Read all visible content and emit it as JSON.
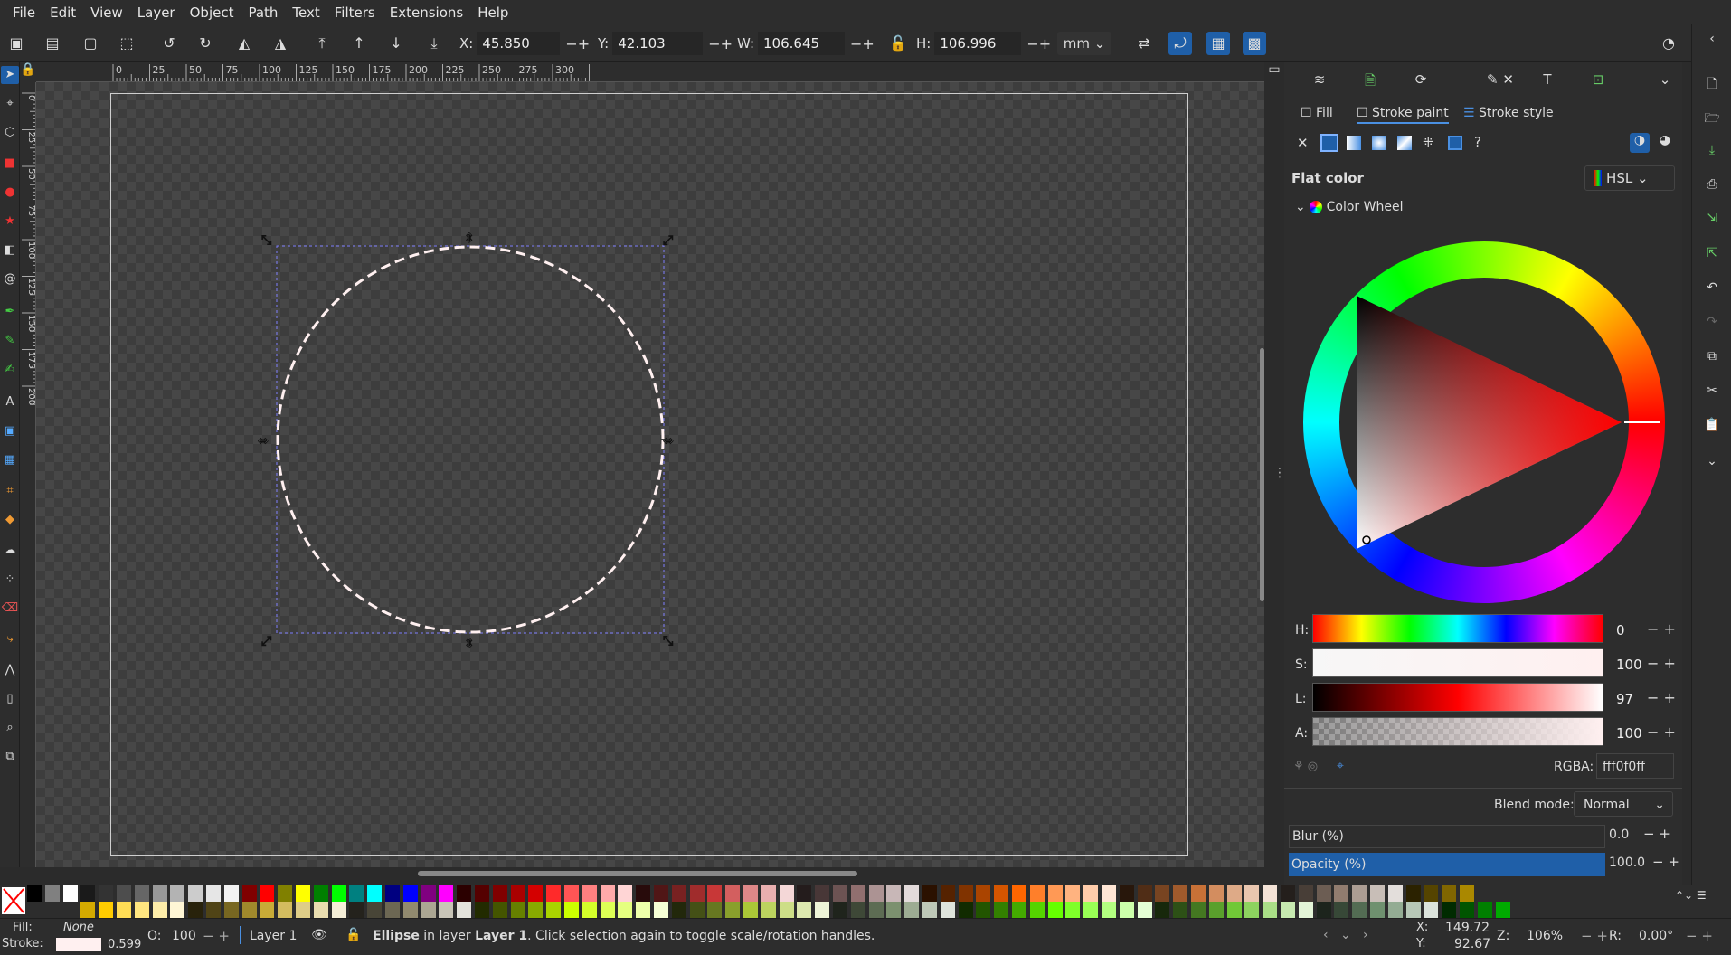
{
  "menu": [
    "File",
    "Edit",
    "View",
    "Layer",
    "Object",
    "Path",
    "Text",
    "Filters",
    "Extensions",
    "Help"
  ],
  "toolbar": {
    "x_label": "X:",
    "x_value": "45.850",
    "y_label": "Y:",
    "y_value": "42.103",
    "w_label": "W:",
    "w_value": "106.645",
    "h_label": "H:",
    "h_value": "106.996",
    "unit": "mm"
  },
  "ruler": {
    "h_ticks": [
      "0",
      "25",
      "50",
      "75",
      "100",
      "125",
      "150",
      "175",
      "200",
      "225",
      "250",
      "275",
      "300"
    ],
    "v_ticks": [
      "0",
      "25",
      "50",
      "75",
      "100",
      "125",
      "150",
      "175",
      "200"
    ]
  },
  "panel": {
    "tabs": {
      "fill": "Fill",
      "stroke_paint": "Stroke paint",
      "stroke_style": "Stroke style"
    },
    "flat_color": "Flat color",
    "color_mode": "HSL",
    "wheel_label": "Color Wheel",
    "h_label": "H:",
    "h_value": "0",
    "s_label": "S:",
    "s_value": "100",
    "l_label": "L:",
    "l_value": "97",
    "a_label": "A:",
    "a_value": "100",
    "rgba_label": "RGBA:",
    "rgba_value": "fff0f0ff",
    "blend_label": "Blend mode:",
    "blend_value": "Normal",
    "blur_label": "Blur (%)",
    "blur_value": "0.0",
    "opacity_label": "Opacity (%)",
    "opacity_value": "100.0"
  },
  "status": {
    "fill_label": "Fill:",
    "fill_value": "None",
    "stroke_label": "Stroke:",
    "stroke_width": "0.599",
    "o_label": "O:",
    "o_value": "100",
    "layer": "Layer 1",
    "msg_obj": "Ellipse",
    "msg_rest1": " in layer ",
    "msg_layer": "Layer 1",
    "msg_rest2": ". Click selection again to toggle scale/rotation handles.",
    "cx": "X:",
    "cx_value": "149.72",
    "cy": "Y:",
    "cy_value": "92.67",
    "z_label": "Z:",
    "z_value": "106%",
    "r_label": "R:",
    "r_value": "0.00°"
  },
  "colors": {
    "accent": "#1f5fa8",
    "stroke_color": "#fff0f0"
  }
}
